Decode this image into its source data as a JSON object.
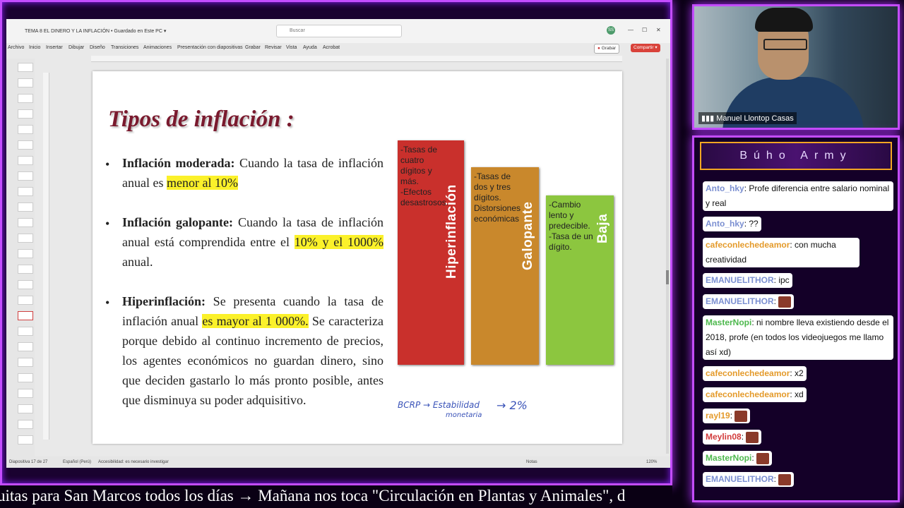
{
  "ppt": {
    "doc_title": "TEMA 8 EL DINERO Y LA INFLACIÓN • Guardado en Este PC ▾",
    "search_placeholder": "Buscar",
    "avatar": "SS",
    "tabs": [
      "Archivo",
      "Inicio",
      "Insertar",
      "Dibujar",
      "Diseño",
      "Transiciones",
      "Animaciones",
      "Presentación con diapositivas",
      "Grabar",
      "Revisar",
      "Vista",
      "Ayuda",
      "Acrobat"
    ],
    "grabar_label": "Grabar",
    "compartir_label": "Compartir",
    "status_slide": "Diapositiva 17 de 27",
    "status_lang": "Español (Perú)",
    "status_access": "Accesibilidad: es necesario investigar",
    "status_notes": "Notas",
    "status_zoom": "120%"
  },
  "slide": {
    "title": "Tipos  de inflación :",
    "bullets": [
      {
        "head": "Inflación moderada:",
        "text_pre": " Cuando la tasa de inflación anual es ",
        "highlight": "menor al 10%",
        "text_post": ""
      },
      {
        "head": "Inflación galopante:",
        "text_pre": " Cuando la tasa de inflación anual está comprendida entre el ",
        "highlight": "10% y el 1000%",
        "text_post": " anual."
      },
      {
        "head": "Hiperinflación:",
        "text_pre": " Se presenta cuando la tasa de inflación anual ",
        "highlight": "es mayor al 1 000%.",
        "text_post": " Se caracteriza porque debido al continuo incremento de precios, los agentes económicos no guardan dinero, sino que deciden gastarlo lo más pronto posible, antes que disminuya su poder adquisitivo."
      }
    ],
    "bars": [
      {
        "name": "Hiperinflación",
        "text": "-Tasas de cuatro dígitos y más.\n-Efectos desastrosos.",
        "color": "#c9302c"
      },
      {
        "name": "Galopante",
        "text": "-Tasas de dos y tres dígitos.\nDistorsiones económicas",
        "color": "#c9882c"
      },
      {
        "name": "Baja",
        "text": "-Cambio lento y predecible.\n-Tasa de un dígito.",
        "color": "#8cc63f"
      }
    ],
    "handwriting_line1": "BCRP → Estabilidad",
    "handwriting_line2": "monetaria",
    "handwriting_value": "→ 2%"
  },
  "cam": {
    "name": "Manuel Llontop Casas"
  },
  "chat": {
    "title": "Búho Army",
    "messages": [
      {
        "user": "Anto_hky",
        "color": "#7b8fd1",
        "text": ": Profe diferencia entre salario nominal y real"
      },
      {
        "user": "Anto_hky",
        "color": "#7b8fd1",
        "text": ": ??"
      },
      {
        "user": "cafeconlechedeamor",
        "color": "#e49a2a",
        "text": ": con mucha creatividad"
      },
      {
        "user": "EMANUELITHOR",
        "color": "#7b8fd1",
        "text": ": ipc"
      },
      {
        "user": "EMANUELITHOR",
        "color": "#7b8fd1",
        "text": ":"
      },
      {
        "user": "MasterNopi",
        "color": "#4db84d",
        "text": ": ni nombre lleva existiendo desde el 2018, profe (en todos los videojuegos me llamo así xd)"
      },
      {
        "user": "cafeconlechedeamor",
        "color": "#e49a2a",
        "text": ": x2"
      },
      {
        "user": "cafeconlechedeamor",
        "color": "#e49a2a",
        "text": ": xd"
      },
      {
        "user": "rayl19",
        "color": "#e49a2a",
        "text": ":"
      },
      {
        "user": "Meylin08",
        "color": "#d23b3b",
        "text": ":"
      },
      {
        "user": "MasterNopi",
        "color": "#4db84d",
        "text": ":"
      },
      {
        "user": "EMANUELITHOR",
        "color": "#7b8fd1",
        "text": ":"
      }
    ]
  },
  "ticker": "uitas para San Marcos todos los días  →  Mañana nos toca \"Circulación en Plantas y Animales\", d"
}
